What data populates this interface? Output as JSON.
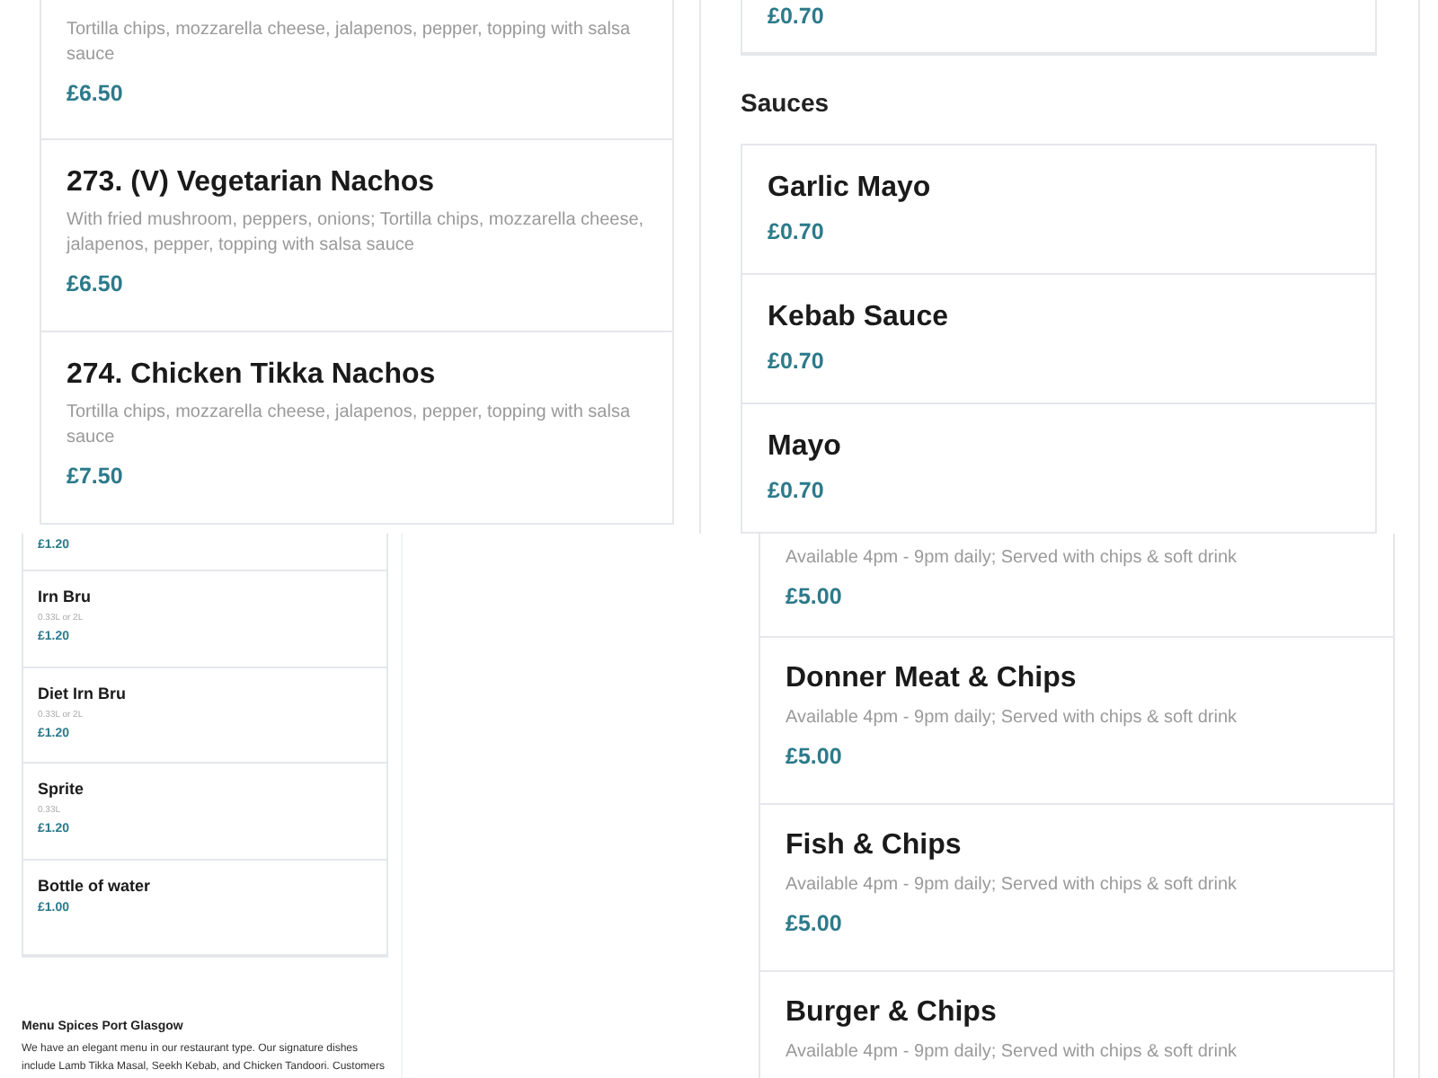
{
  "nachos": {
    "items": [
      {
        "description": "Tortilla chips, mozzarella cheese, jalapenos, pepper, topping with salsa sauce",
        "price": "£6.50"
      },
      {
        "name": "273. (V) Vegetarian Nachos",
        "description": "With fried mushroom, peppers, onions; Tortilla chips, mozzarella cheese, jalapenos, pepper, topping with salsa sauce",
        "price": "£6.50"
      },
      {
        "name": "274. Chicken Tikka Nachos",
        "description": "Tortilla chips, mozzarella cheese, jalapenos, pepper, topping with salsa sauce",
        "price": "£7.50"
      }
    ]
  },
  "extras": {
    "items": [
      {
        "price": "£0.70"
      }
    ]
  },
  "sauces": {
    "heading": "Sauces",
    "items": [
      {
        "name": "Garlic Mayo",
        "price": "£0.70"
      },
      {
        "name": "Kebab Sauce",
        "price": "£0.70"
      },
      {
        "name": "Mayo",
        "price": "£0.70"
      }
    ]
  },
  "drinks": {
    "items": [
      {
        "price": "£1.20"
      },
      {
        "name": "Irn Bru",
        "size": "0.33L or 2L",
        "price": "£1.20"
      },
      {
        "name": "Diet Irn Bru",
        "size": "0.33L or 2L",
        "price": "£1.20"
      },
      {
        "name": "Sprite",
        "size": "0.33L",
        "price": "£1.20"
      },
      {
        "name": "Bottle of water",
        "price": "£1.00"
      }
    ]
  },
  "footer": {
    "title": "Menu Spices Port Glasgow",
    "text": [
      "We have an elegant menu in our restaurant type. Our signature dishes",
      "include Lamb Tikka Masal, Seekh Kebab, and Chicken Tandoori. Customers"
    ]
  },
  "meals": {
    "items": [
      {
        "description": "Available 4pm - 9pm daily; Served with chips & soft drink",
        "price": "£5.00"
      },
      {
        "name": "Donner Meat & Chips",
        "description": "Available 4pm - 9pm daily; Served with chips & soft drink",
        "price": "£5.00"
      },
      {
        "name": "Fish & Chips",
        "description": "Available 4pm - 9pm daily; Served with chips & soft drink",
        "price": "£5.00"
      },
      {
        "name": "Burger & Chips",
        "description": "Available 4pm - 9pm daily; Served with chips & soft drink"
      }
    ]
  }
}
